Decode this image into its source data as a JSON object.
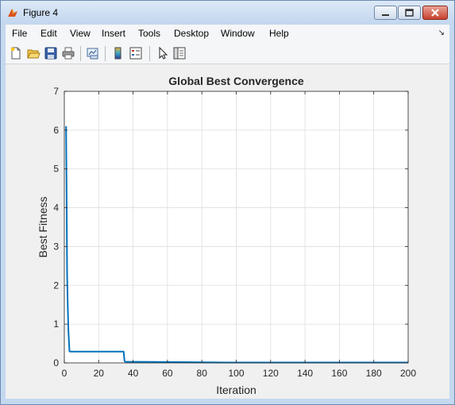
{
  "window": {
    "title": "Figure 4"
  },
  "menu": {
    "items": [
      "File",
      "Edit",
      "View",
      "Insert",
      "Tools",
      "Desktop",
      "Window",
      "Help"
    ]
  },
  "toolbar": {
    "buttons": [
      "new-figure-icon",
      "open-file-icon",
      "save-icon",
      "print-icon",
      "link-plot-icon",
      "colorbar-icon",
      "legend-icon",
      "pointer-icon",
      "property-editor-icon"
    ]
  },
  "chart_data": {
    "type": "line",
    "title": "Global Best Convergence",
    "xlabel": "Iteration",
    "ylabel": "Best Fitness",
    "xlim": [
      0,
      200
    ],
    "ylim": [
      0,
      7
    ],
    "xticks": [
      "0",
      "20",
      "40",
      "60",
      "80",
      "100",
      "120",
      "140",
      "160",
      "180",
      "200"
    ],
    "yticks": [
      "0",
      "1",
      "2",
      "3",
      "4",
      "5",
      "6",
      "7"
    ],
    "grid": true,
    "line_color": "#0072bd",
    "series": [
      {
        "x": [
          1,
          1.3,
          1.6,
          2,
          2.4,
          3,
          3.5,
          4,
          34.5,
          35,
          35.5,
          95,
          200
        ],
        "y": [
          6.1,
          4.6,
          2.3,
          1.5,
          0.8,
          0.3,
          0.29,
          0.29,
          0.29,
          0.05,
          0.03,
          0.01,
          0.01
        ]
      }
    ]
  }
}
